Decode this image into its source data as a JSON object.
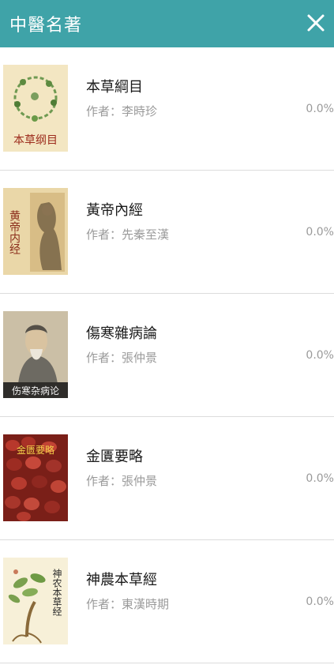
{
  "header": {
    "title": "中醫名著",
    "close_icon": "close-icon"
  },
  "colors": {
    "header_bg": "#3fa3a8",
    "title_text": "#1a1a1a",
    "secondary_text": "#9a9a9a",
    "divider": "#dcdcdc"
  },
  "books": [
    {
      "title": "本草綱目",
      "author_prefix": "作者：",
      "author": "李時珍",
      "progress": "0.0%",
      "cover_text": "本草纲目"
    },
    {
      "title": "黃帝內經",
      "author_prefix": "作者：",
      "author": "先秦至漢",
      "progress": "0.0%",
      "cover_text": "黄帝内经"
    },
    {
      "title": "傷寒雜病論",
      "author_prefix": "作者：",
      "author": "張仲景",
      "progress": "0.0%",
      "cover_text": "伤寒杂病论"
    },
    {
      "title": "金匱要略",
      "author_prefix": "作者：",
      "author": "張仲景",
      "progress": "0.0%",
      "cover_text": "金匮要略"
    },
    {
      "title": "神農本草經",
      "author_prefix": "作者：",
      "author": "東漢時期",
      "progress": "0.0%",
      "cover_text": "神农本草经"
    }
  ]
}
